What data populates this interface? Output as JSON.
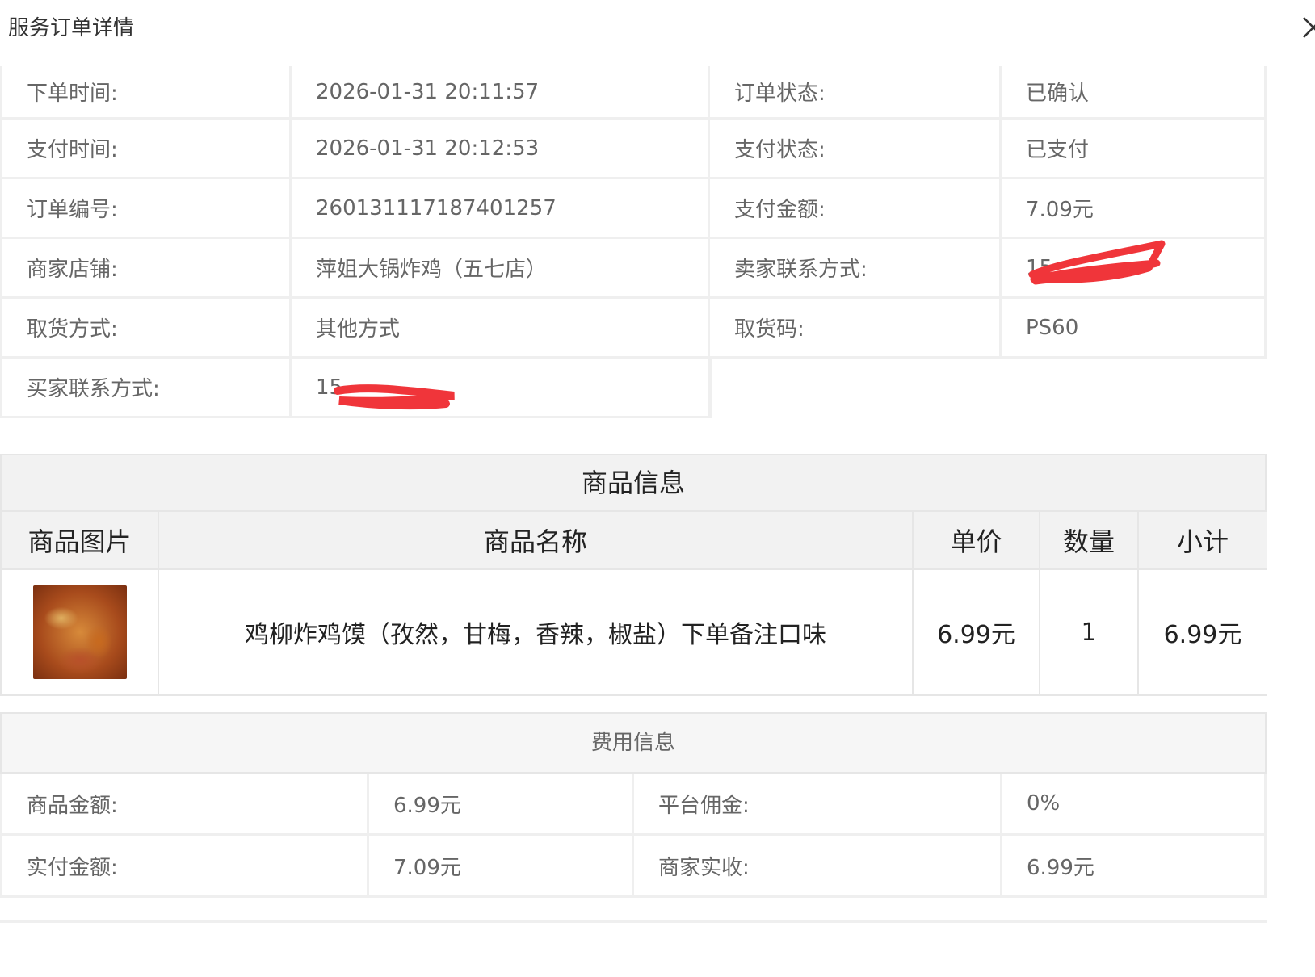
{
  "dialog": {
    "title": "服务订单详情"
  },
  "order_info": {
    "order_time_label": "下单时间:",
    "order_time": "2026-01-31 20:11:57",
    "order_status_label": "订单状态:",
    "order_status": "已确认",
    "pay_time_label": "支付时间:",
    "pay_time": "2026-01-31 20:12:53",
    "pay_status_label": "支付状态:",
    "pay_status": "已支付",
    "order_no_label": "订单编号:",
    "order_no": "260131117187401257",
    "pay_amount_label": "支付金额:",
    "pay_amount": "7.09元",
    "shop_label": "商家店铺:",
    "shop": "萍姐大锅炸鸡（五七店）",
    "seller_contact_label": "卖家联系方式:",
    "seller_contact": "15",
    "pickup_method_label": "取货方式:",
    "pickup_method": "其他方式",
    "pickup_code_label": "取货码:",
    "pickup_code": "PS60",
    "buyer_contact_label": "买家联系方式:",
    "buyer_contact": "15"
  },
  "goods": {
    "section_title": "商品信息",
    "headers": [
      "商品图片",
      "商品名称",
      "单价",
      "数量",
      "小计"
    ],
    "items": [
      {
        "image_icon": "fried-chicken-photo",
        "name": "鸡柳炸鸡馍（孜然，甘梅，香辣，椒盐）下单备注口味",
        "price": "6.99元",
        "qty": "1",
        "subtotal": "6.99元"
      }
    ]
  },
  "fees": {
    "section_title": "费用信息",
    "goods_amount_label": "商品金额:",
    "goods_amount": "6.99元",
    "commission_label": "平台佣金:",
    "commission": "0%",
    "paid_amount_label": "实付金额:",
    "paid_amount": "7.09元",
    "merchant_income_label": "商家实收:",
    "merchant_income": "6.99元"
  },
  "colors": {
    "redaction": "#f0353a",
    "header_bg": "#f2f2f2",
    "border": "#efefef"
  }
}
